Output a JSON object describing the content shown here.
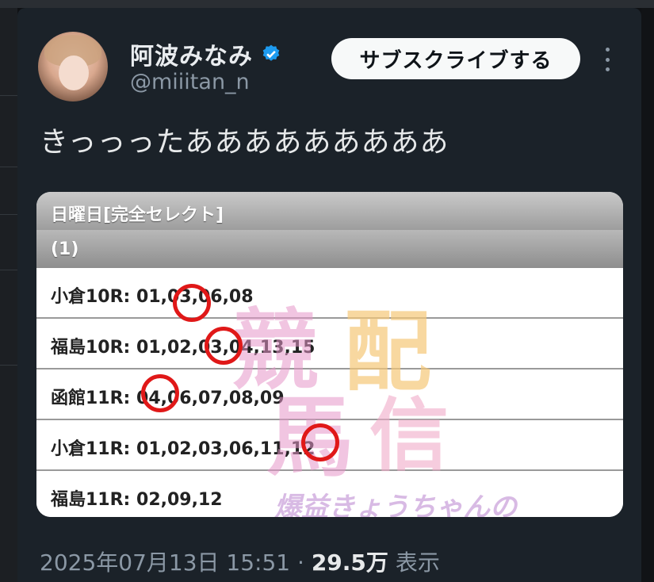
{
  "user": {
    "name": "阿波みなみ",
    "handle": "@miiitan_n",
    "verified": true
  },
  "subscribe_label": "サブスクライブする",
  "tweet_text": "きっっったあああああああああ",
  "image": {
    "header": "日曜日[完全セレクト]",
    "subheader": "(1)",
    "rows": [
      "小倉10R: 01,03,06,08",
      "福島10R: 01,02,03,04,13,15",
      "函館11R: 04,06,07,08,09",
      "小倉11R: 01,02,03,06,11,12",
      "福島11R: 02,09,12"
    ],
    "watermark": [
      "競",
      "配",
      "馬",
      "信",
      "爆益きょうちゃんの"
    ]
  },
  "meta": {
    "date": "2025年07月13日 15:51",
    "separator": "·",
    "views_count": "29.5万",
    "views_label": "表示"
  },
  "colors": {
    "background": "#1b2229",
    "verified_badge": "#1d9bf0",
    "circle": "#e01818"
  }
}
